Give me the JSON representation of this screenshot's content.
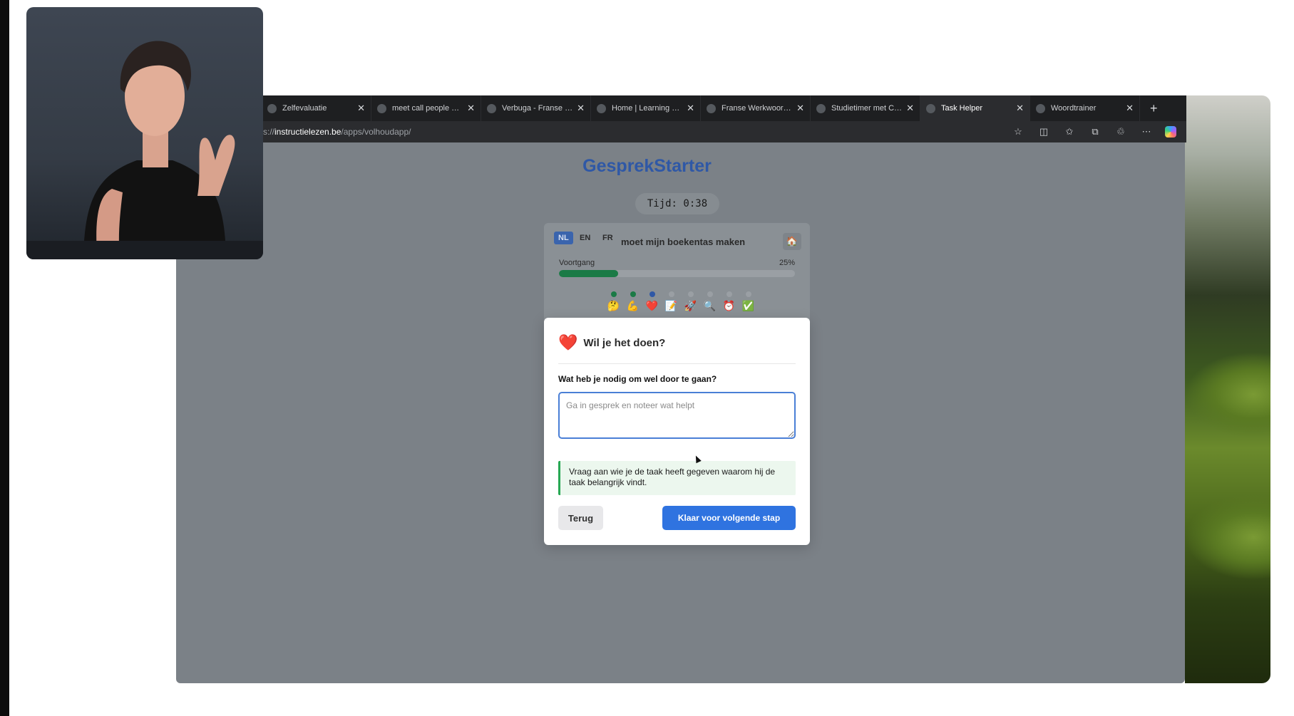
{
  "browser": {
    "tabs": [
      {
        "title": "Zelfevaluatie",
        "active": false,
        "icon": "globe-icon"
      },
      {
        "title": "meet call people doing",
        "active": false,
        "icon": "google-icon"
      },
      {
        "title": "Verbuga - Franse werk",
        "active": false,
        "icon": "doc-icon"
      },
      {
        "title": "Home | Learning with",
        "active": false,
        "icon": "site-icon"
      },
      {
        "title": "Franse Werkwoorden",
        "active": false,
        "icon": "site-icon"
      },
      {
        "title": "Studietimer met Chec",
        "active": false,
        "icon": "doc-icon"
      },
      {
        "title": "Task Helper",
        "active": true,
        "icon": "app-icon"
      },
      {
        "title": "Woordtrainer",
        "active": false,
        "icon": "globe-icon"
      }
    ],
    "new_tab_label": "+",
    "url_prefix": "s://",
    "url_host": "instructielezen.be",
    "url_path": "/apps/volhoudapp/"
  },
  "app": {
    "title": "GesprekStarter",
    "timer": "Tijd: 0:38",
    "languages": {
      "nl": "NL",
      "en": "EN",
      "fr": "FR",
      "selected": "NL"
    },
    "task": "moet mijn boekentas maken",
    "progress": {
      "label": "Voortgang",
      "percent_text": "25%",
      "value": 0.25
    },
    "steps": [
      {
        "emoji": "🤔",
        "state": "done"
      },
      {
        "emoji": "💪",
        "state": "done"
      },
      {
        "emoji": "❤️",
        "state": "current"
      },
      {
        "emoji": "📝",
        "state": "todo"
      },
      {
        "emoji": "🚀",
        "state": "todo"
      },
      {
        "emoji": "🔍",
        "state": "todo"
      },
      {
        "emoji": "⏰",
        "state": "todo"
      },
      {
        "emoji": "✅",
        "state": "todo"
      }
    ]
  },
  "modal": {
    "icon": "❤️",
    "title": "Wil je het doen?",
    "question": "Wat heb je nodig om wel door te gaan?",
    "answer_value": "",
    "answer_placeholder": "Ga in gesprek en noteer wat helpt",
    "tip": "Vraag aan wie je de taak heeft gegeven waarom hij de taak belangrijk vindt.",
    "back_label": "Terug",
    "next_label": "Klaar voor volgende stap"
  },
  "colors": {
    "accent_blue": "#2f73e0",
    "title_blue": "#2f58a6",
    "progress_green": "#1b7a46",
    "tip_green": "#27a853",
    "heart_red": "#e0262a"
  }
}
